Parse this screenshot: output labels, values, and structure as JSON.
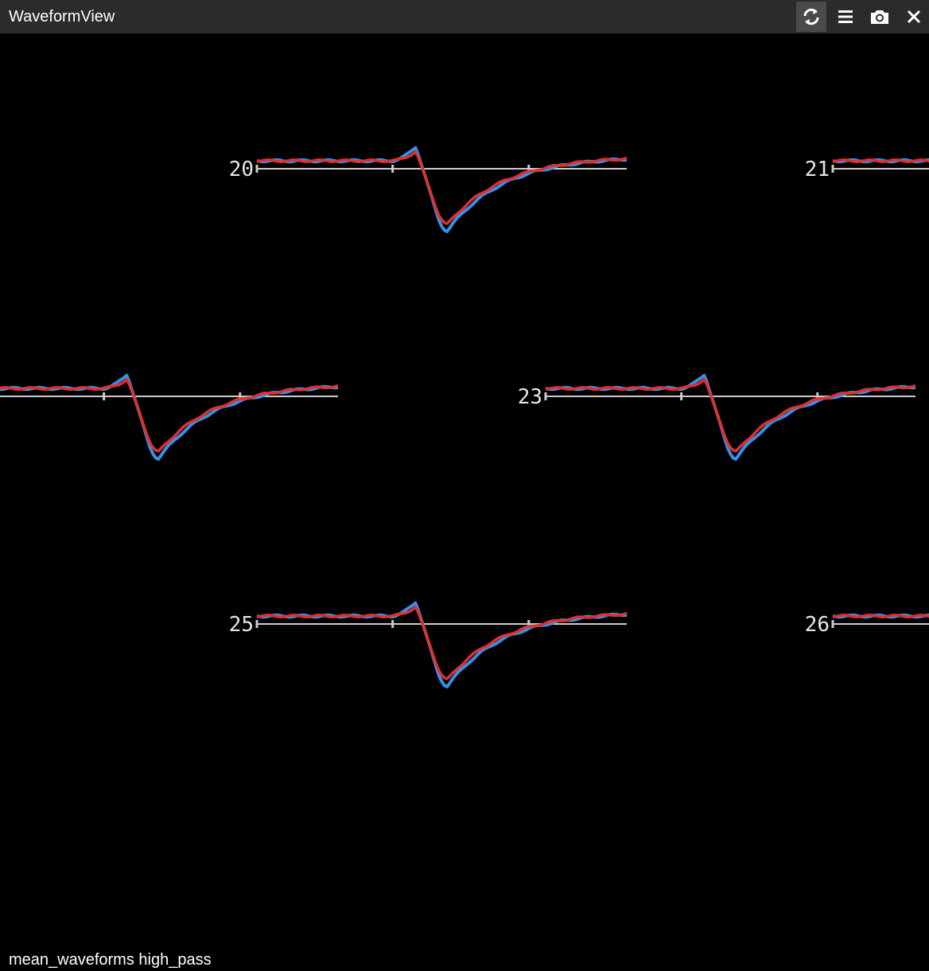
{
  "window": {
    "title": "WaveformView",
    "tools": [
      {
        "name": "refresh-icon",
        "active": true
      },
      {
        "name": "menu-icon",
        "active": false
      },
      {
        "name": "camera-icon",
        "active": false
      },
      {
        "name": "close-icon",
        "active": false
      }
    ]
  },
  "status_text": "mean_waveforms high_pass",
  "colors": {
    "background": "#000000",
    "titlebar": "#2b2b2b",
    "baseline": "#cccccc",
    "channel_label": "#e6e6e6",
    "series_blue": "#3a8ee6",
    "series_red": "#e0302b"
  },
  "chart_data": {
    "type": "line",
    "channels": [
      {
        "label": "20"
      },
      {
        "label": "21"
      },
      {
        "label": ""
      },
      {
        "label": "23"
      },
      {
        "label": "25"
      },
      {
        "label": "26"
      }
    ],
    "series": [
      {
        "color": "#3a8ee6"
      },
      {
        "color": "#e0302b"
      }
    ]
  }
}
